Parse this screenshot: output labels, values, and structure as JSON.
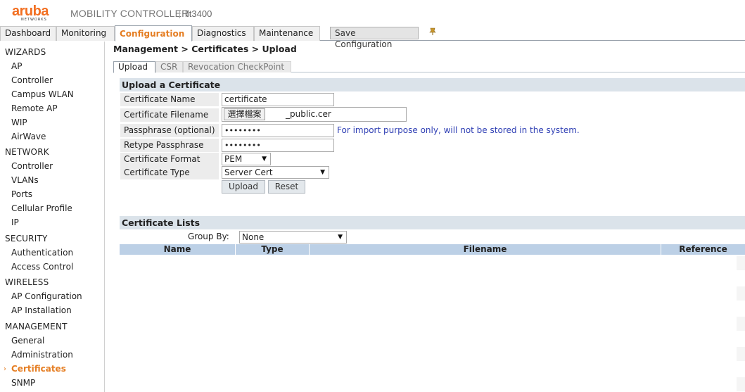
{
  "header": {
    "logo_text": "aruba",
    "logo_sub": "NETWORKS",
    "product": "MOBILITY CONTROLLER",
    "hostname": "llt3400"
  },
  "topnav": {
    "tabs": [
      {
        "label": "Dashboard"
      },
      {
        "label": "Monitoring"
      },
      {
        "label": "Configuration"
      },
      {
        "label": "Diagnostics"
      },
      {
        "label": "Maintenance"
      }
    ],
    "save_label": "Save Configuration",
    "pin_icon": "pin-icon",
    "accent_color": "#e57e23"
  },
  "sidebar": {
    "sections": [
      {
        "title": "WIZARDS",
        "items": [
          "AP",
          "Controller",
          "Campus WLAN",
          "Remote AP",
          "WIP",
          "AirWave"
        ]
      },
      {
        "title": "NETWORK",
        "items": [
          "Controller",
          "VLANs",
          "Ports",
          "Cellular Profile",
          "IP"
        ]
      },
      {
        "title": "SECURITY",
        "items": [
          "Authentication",
          "Access Control"
        ]
      },
      {
        "title": "WIRELESS",
        "items": [
          "AP Configuration",
          "AP Installation"
        ]
      },
      {
        "title": "MANAGEMENT",
        "items": [
          "General",
          "Administration",
          "Certificates",
          "SNMP"
        ]
      }
    ],
    "active_item": "Certificates"
  },
  "main": {
    "breadcrumb": "Management > Certificates > Upload",
    "subtabs": [
      {
        "label": "Upload"
      },
      {
        "label": "CSR"
      },
      {
        "label": "Revocation CheckPoint"
      }
    ],
    "upload_section": {
      "title": "Upload a Certificate",
      "fields": {
        "cert_name_label": "Certificate Name",
        "cert_name_value": "certificate",
        "cert_filename_label": "Certificate Filename",
        "file_button": "選擇檔案",
        "file_name": "_public.cer",
        "passphrase_label": "Passphrase (optional)",
        "passphrase_value": "••••••••",
        "passphrase_hint": "For import purpose only, will not be stored in the system.",
        "retype_label": "Retype Passphrase",
        "retype_value": "••••••••",
        "format_label": "Certificate Format",
        "format_value": "PEM",
        "type_label": "Certificate Type",
        "type_value": "Server Cert"
      },
      "upload_button": "Upload",
      "reset_button": "Reset"
    },
    "lists_section": {
      "title": "Certificate Lists",
      "group_by_label": "Group By:",
      "group_by_value": "None",
      "columns": [
        "Name",
        "Type",
        "Filename",
        "Reference"
      ]
    }
  }
}
